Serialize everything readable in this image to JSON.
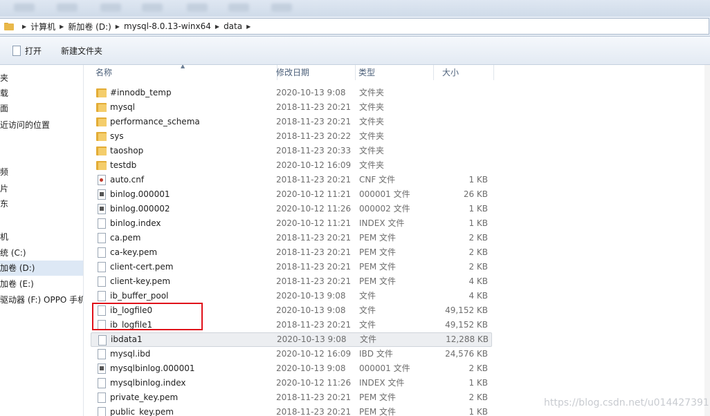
{
  "address": {
    "crumbs": [
      "计算机",
      "新加卷 (D:)",
      "mysql-8.0.13-winx64",
      "data"
    ]
  },
  "toolbar": {
    "open_label": "打开",
    "new_folder_label": "新建文件夹"
  },
  "sidebar": {
    "items": [
      "夹",
      "载",
      "面",
      "近访问的位置",
      "",
      "",
      "频",
      "片",
      "东",
      "",
      "机",
      "统 (C:)",
      "加卷 (D:)",
      "加卷 (E:)",
      "驱动器 (F:) OPPO 手机"
    ]
  },
  "columns": {
    "name": "名称",
    "date": "修改日期",
    "type": "类型",
    "size": "大小"
  },
  "files": [
    {
      "name": "#innodb_temp",
      "date": "2020-10-13 9:08",
      "type": "文件夹",
      "size": "",
      "icon": "folder-icon"
    },
    {
      "name": "mysql",
      "date": "2018-11-23 20:21",
      "type": "文件夹",
      "size": "",
      "icon": "folder-icon"
    },
    {
      "name": "performance_schema",
      "date": "2018-11-23 20:21",
      "type": "文件夹",
      "size": "",
      "icon": "folder-icon"
    },
    {
      "name": "sys",
      "date": "2018-11-23 20:22",
      "type": "文件夹",
      "size": "",
      "icon": "folder-icon"
    },
    {
      "name": "taoshop",
      "date": "2018-11-23 20:33",
      "type": "文件夹",
      "size": "",
      "icon": "folder-icon"
    },
    {
      "name": "testdb",
      "date": "2020-10-12 16:09",
      "type": "文件夹",
      "size": "",
      "icon": "folder-icon"
    },
    {
      "name": "auto.cnf",
      "date": "2018-11-23 20:21",
      "type": "CNF 文件",
      "size": "1 KB",
      "icon": "config-file-icon"
    },
    {
      "name": "binlog.000001",
      "date": "2020-10-12 11:21",
      "type": "000001 文件",
      "size": "26 KB",
      "icon": "binary-file-icon"
    },
    {
      "name": "binlog.000002",
      "date": "2020-10-12 11:26",
      "type": "000002 文件",
      "size": "1 KB",
      "icon": "binary-file-icon"
    },
    {
      "name": "binlog.index",
      "date": "2020-10-12 11:21",
      "type": "INDEX 文件",
      "size": "1 KB",
      "icon": "file-icon"
    },
    {
      "name": "ca.pem",
      "date": "2018-11-23 20:21",
      "type": "PEM 文件",
      "size": "2 KB",
      "icon": "file-icon"
    },
    {
      "name": "ca-key.pem",
      "date": "2018-11-23 20:21",
      "type": "PEM 文件",
      "size": "2 KB",
      "icon": "file-icon"
    },
    {
      "name": "client-cert.pem",
      "date": "2018-11-23 20:21",
      "type": "PEM 文件",
      "size": "2 KB",
      "icon": "file-icon"
    },
    {
      "name": "client-key.pem",
      "date": "2018-11-23 20:21",
      "type": "PEM 文件",
      "size": "4 KB",
      "icon": "file-icon"
    },
    {
      "name": "ib_buffer_pool",
      "date": "2020-10-13 9:08",
      "type": "文件",
      "size": "4 KB",
      "icon": "file-icon"
    },
    {
      "name": "ib_logfile0",
      "date": "2020-10-13 9:08",
      "type": "文件",
      "size": "49,152 KB",
      "icon": "file-icon"
    },
    {
      "name": "ib_logfile1",
      "date": "2018-11-23 20:21",
      "type": "文件",
      "size": "49,152 KB",
      "icon": "file-icon"
    },
    {
      "name": "ibdata1",
      "date": "2020-10-13 9:08",
      "type": "文件",
      "size": "12,288 KB",
      "icon": "file-icon"
    },
    {
      "name": "mysql.ibd",
      "date": "2020-10-12 16:09",
      "type": "IBD 文件",
      "size": "24,576 KB",
      "icon": "file-icon"
    },
    {
      "name": "mysqlbinlog.000001",
      "date": "2020-10-13 9:08",
      "type": "000001 文件",
      "size": "2 KB",
      "icon": "binary-file-icon"
    },
    {
      "name": "mysqlbinlog.index",
      "date": "2020-10-12 11:26",
      "type": "INDEX 文件",
      "size": "1 KB",
      "icon": "file-icon"
    },
    {
      "name": "private_key.pem",
      "date": "2018-11-23 20:21",
      "type": "PEM 文件",
      "size": "2 KB",
      "icon": "file-icon"
    },
    {
      "name": "public_key.pem",
      "date": "2018-11-23 20:21",
      "type": "PEM 文件",
      "size": "1 KB",
      "icon": "file-icon"
    }
  ],
  "highlighted_file": "ibdata1",
  "watermark": "https://blog.csdn.net/u014427391",
  "colors": {
    "annotation_box": "#e0101a",
    "folder": "#e3ac36",
    "selection": "#dde8f5"
  }
}
